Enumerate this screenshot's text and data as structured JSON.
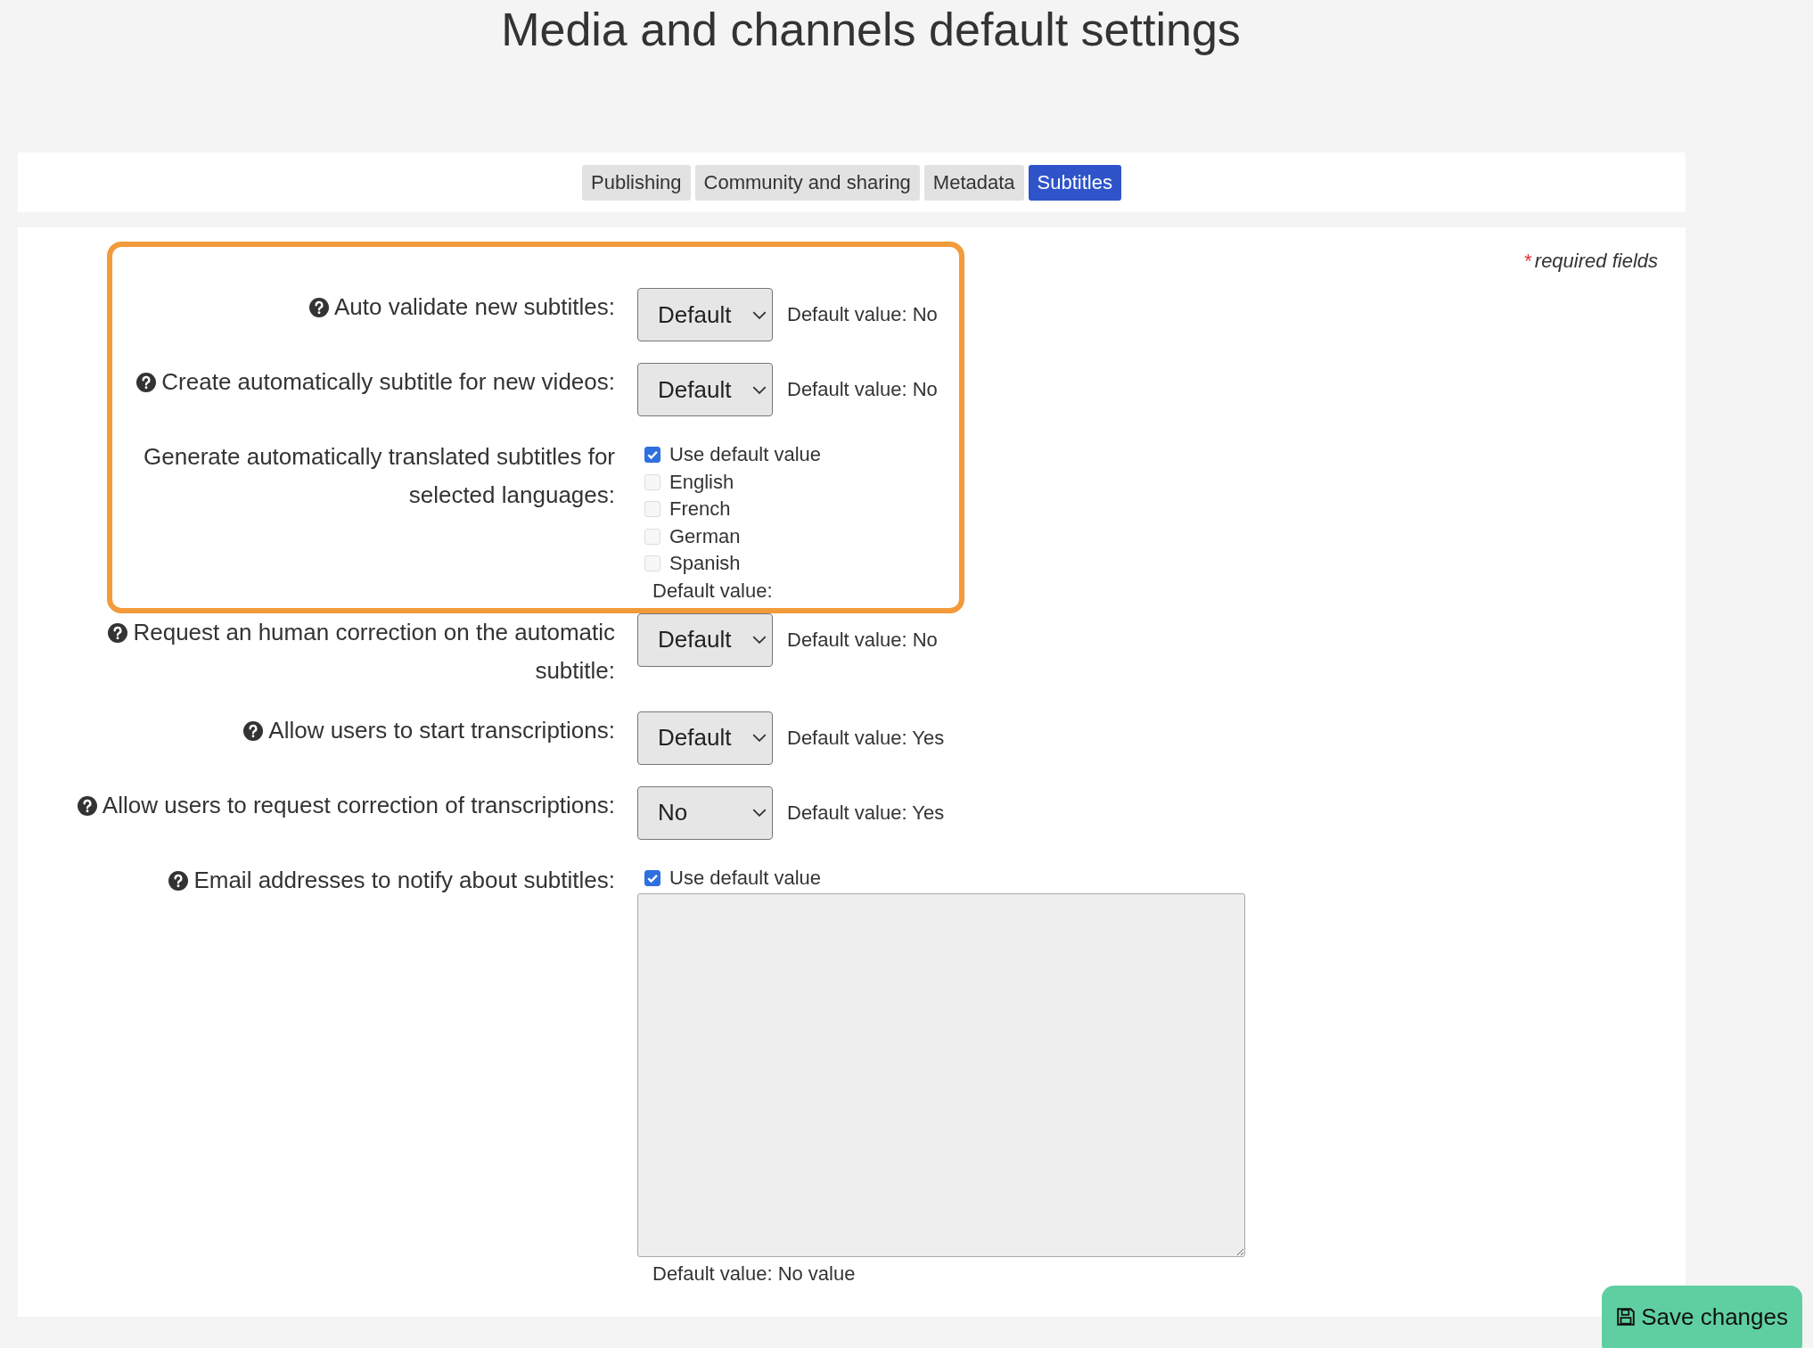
{
  "title": "Media and channels default settings",
  "tabs": [
    {
      "label": "Publishing",
      "selected": false
    },
    {
      "label": "Community and sharing",
      "selected": false
    },
    {
      "label": "Metadata",
      "selected": false
    },
    {
      "label": "Subtitles",
      "selected": true
    }
  ],
  "required_note": {
    "mark": "*",
    "text": "required fields"
  },
  "fields": [
    {
      "kind": "select",
      "label": "Auto validate new subtitles:",
      "help": true,
      "highlighted": true,
      "value": "Default",
      "default_text": "Default value: No"
    },
    {
      "kind": "select",
      "label": "Create automatically subtitle for new videos:",
      "help": true,
      "highlighted": true,
      "value": "Default",
      "default_text": "Default value: No"
    },
    {
      "kind": "checklist",
      "label": "Generate automatically translated subtitles for selected languages:",
      "help": false,
      "highlighted": true,
      "options": [
        {
          "label": "Use default value",
          "checked": true
        },
        {
          "label": "English",
          "checked": false,
          "disabled": true
        },
        {
          "label": "French",
          "checked": false,
          "disabled": true
        },
        {
          "label": "German",
          "checked": false,
          "disabled": true
        },
        {
          "label": "Spanish",
          "checked": false,
          "disabled": true
        }
      ],
      "default_text": "Default value:"
    },
    {
      "kind": "select",
      "label": "Request an human correction on the automatic subtitle:",
      "help": true,
      "highlighted": false,
      "value": "Default",
      "default_text": "Default value: No"
    },
    {
      "kind": "select",
      "label": "Allow users to start transcriptions:",
      "help": true,
      "highlighted": false,
      "value": "Default",
      "default_text": "Default value: Yes"
    },
    {
      "kind": "select",
      "label": "Allow users to request correction of transcriptions:",
      "help": true,
      "highlighted": false,
      "value": "No",
      "default_text": "Default value: Yes"
    },
    {
      "kind": "textarea",
      "label": "Email addresses to notify about subtitles:",
      "help": true,
      "highlighted": false,
      "use_default": {
        "label": "Use default value",
        "checked": true
      },
      "disabled": true,
      "default_text": "Default value: No value"
    }
  ],
  "save_button": "Save changes"
}
